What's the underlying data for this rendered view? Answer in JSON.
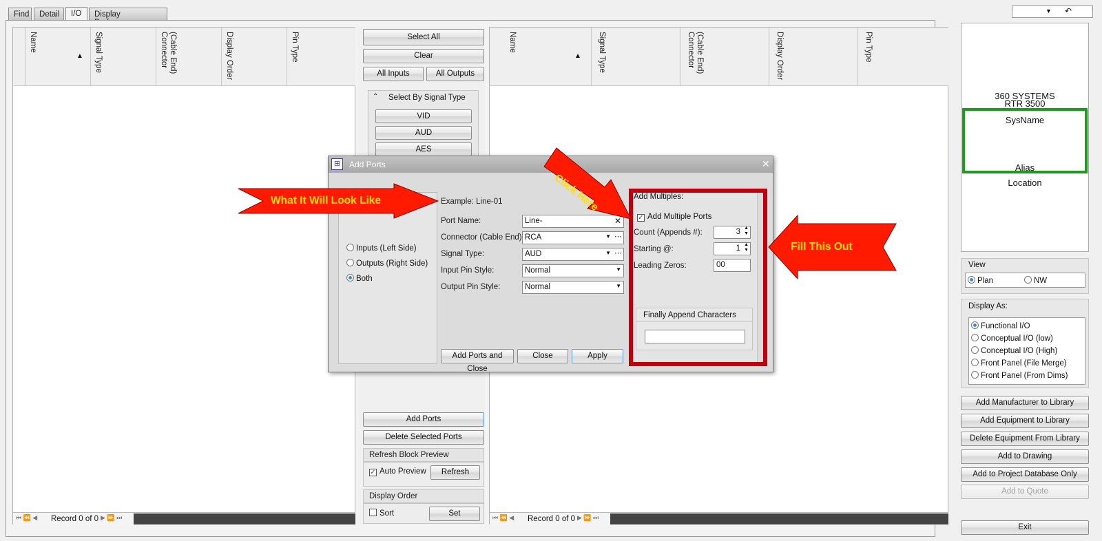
{
  "tabs": [
    "Find",
    "Detail",
    "I/O",
    "Display Preferences"
  ],
  "top_right": {
    "dropdown_icon": "chevron-down-icon",
    "undo_icon": "undo-icon"
  },
  "left_grid": {
    "columns": [
      "Name",
      "Signal Type",
      "(Cable End)\nConnector",
      "Display Order",
      "Pin Type"
    ],
    "sort_indicator": "▲",
    "nav_record": "Record 0 of 0"
  },
  "right_grid": {
    "columns": [
      "Name",
      "Signal Type",
      "(Cable End)\nConnector",
      "Display Order",
      "Pin Type"
    ],
    "sort_indicator": "▲",
    "nav_record": "Record 0 of 0"
  },
  "middle": {
    "select_all": "Select All",
    "clear": "Clear",
    "all_inputs": "All Inputs",
    "all_outputs": "All Outputs",
    "select_by_signal_type": "Select By Signal Type",
    "signal_types": [
      "VID",
      "AUD",
      "AES"
    ],
    "add_ports": "Add Ports",
    "delete_selected_ports": "Delete Selected Ports",
    "refresh_block_preview": "Refresh Block Preview",
    "auto_preview": "Auto Preview",
    "refresh": "Refresh",
    "display_order": "Display Order",
    "sort": "Sort",
    "set": "Set"
  },
  "dialog": {
    "title": "Add Ports",
    "example": "Example: Line-01",
    "side_options": [
      "Inputs (Left Side)",
      "Outputs (Right Side)",
      "Both"
    ],
    "port_name_label": "Port Name:",
    "port_name_value": "Line-",
    "connector_label": "Connector (Cable End):",
    "connector_value": "RCA",
    "signal_type_label": "Signal Type:",
    "signal_type_value": "AUD",
    "input_pin_label": "Input Pin Style:",
    "input_pin_value": "Normal",
    "output_pin_label": "Output Pin Style:",
    "output_pin_value": "Normal",
    "add_multiples": "Add Multiples:",
    "add_multiple_ports": "Add Multiple Ports",
    "count_label": "Count (Appends #):",
    "count_value": "3",
    "starting_label": "Starting @:",
    "starting_value": "1",
    "leading_zeros_label": "Leading Zeros:",
    "leading_zeros_value": "00",
    "finally_append": "Finally Append Characters",
    "add_ports_and_close": "Add Ports and Close",
    "close": "Close",
    "apply": "Apply"
  },
  "annotations": {
    "what_it_will_look_like": "What It Will Look Like",
    "click_here": "Click Here",
    "fill_this_out": "Fill This Out",
    "arrow_color": "#ff1a00",
    "text_color": "#ffe000",
    "box_color": "#c0000a"
  },
  "preview": {
    "manufacturer": "360 SYSTEMS",
    "model": "RTR 3500",
    "sysname": "SysName",
    "alias": "Alias",
    "location": "Location",
    "highlight_color": "#1e9a1e"
  },
  "view": {
    "label": "View",
    "options": [
      "Plan",
      "NW"
    ]
  },
  "display_as": {
    "label": "Display As:",
    "options": [
      "Functional I/O",
      "Conceptual I/O (low)",
      "Conceptual I/O (High)",
      "Front Panel (File Merge)",
      "Front Panel (From Dims)"
    ]
  },
  "actions": [
    "Add Manufacturer to Library",
    "Add Equipment to Library",
    "Delete Equipment From Library",
    "Add to Drawing",
    "Add to Project Database Only",
    "Add to Quote"
  ],
  "exit": "Exit"
}
